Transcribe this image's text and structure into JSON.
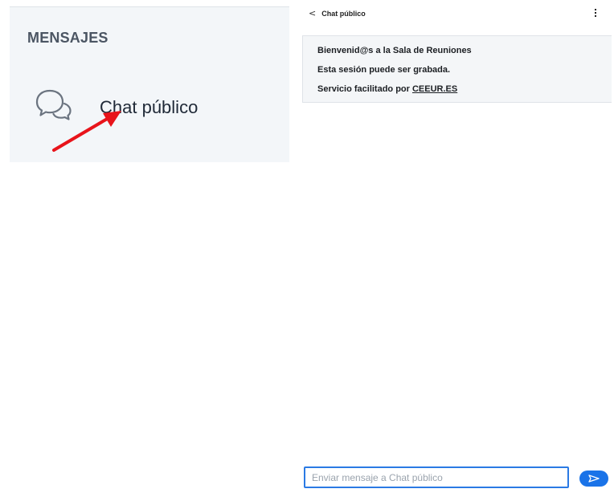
{
  "sidebar": {
    "title": "MENSAJES",
    "chat_item": {
      "label": "Chat público",
      "icon": "chat-bubbles-icon"
    }
  },
  "annotation": {
    "arrow_color": "#e8141b"
  },
  "chat": {
    "header": {
      "back_icon": "<",
      "title": "Chat público",
      "menu_icon": "more-vertical-icon"
    },
    "welcome": {
      "line1": "Bienvenid@s a la Sala de Reuniones",
      "line2": "Esta sesión puede ser grabada.",
      "line3_prefix": "Servicio facilitado por ",
      "line3_link": "CEEUR.ES"
    },
    "input": {
      "placeholder": "Enviar mensaje a Chat público",
      "value": ""
    },
    "send_icon": "send-icon"
  },
  "colors": {
    "accent": "#1a73e8",
    "input_border": "#2b7ae4",
    "panel_bg": "#f3f6f9"
  }
}
